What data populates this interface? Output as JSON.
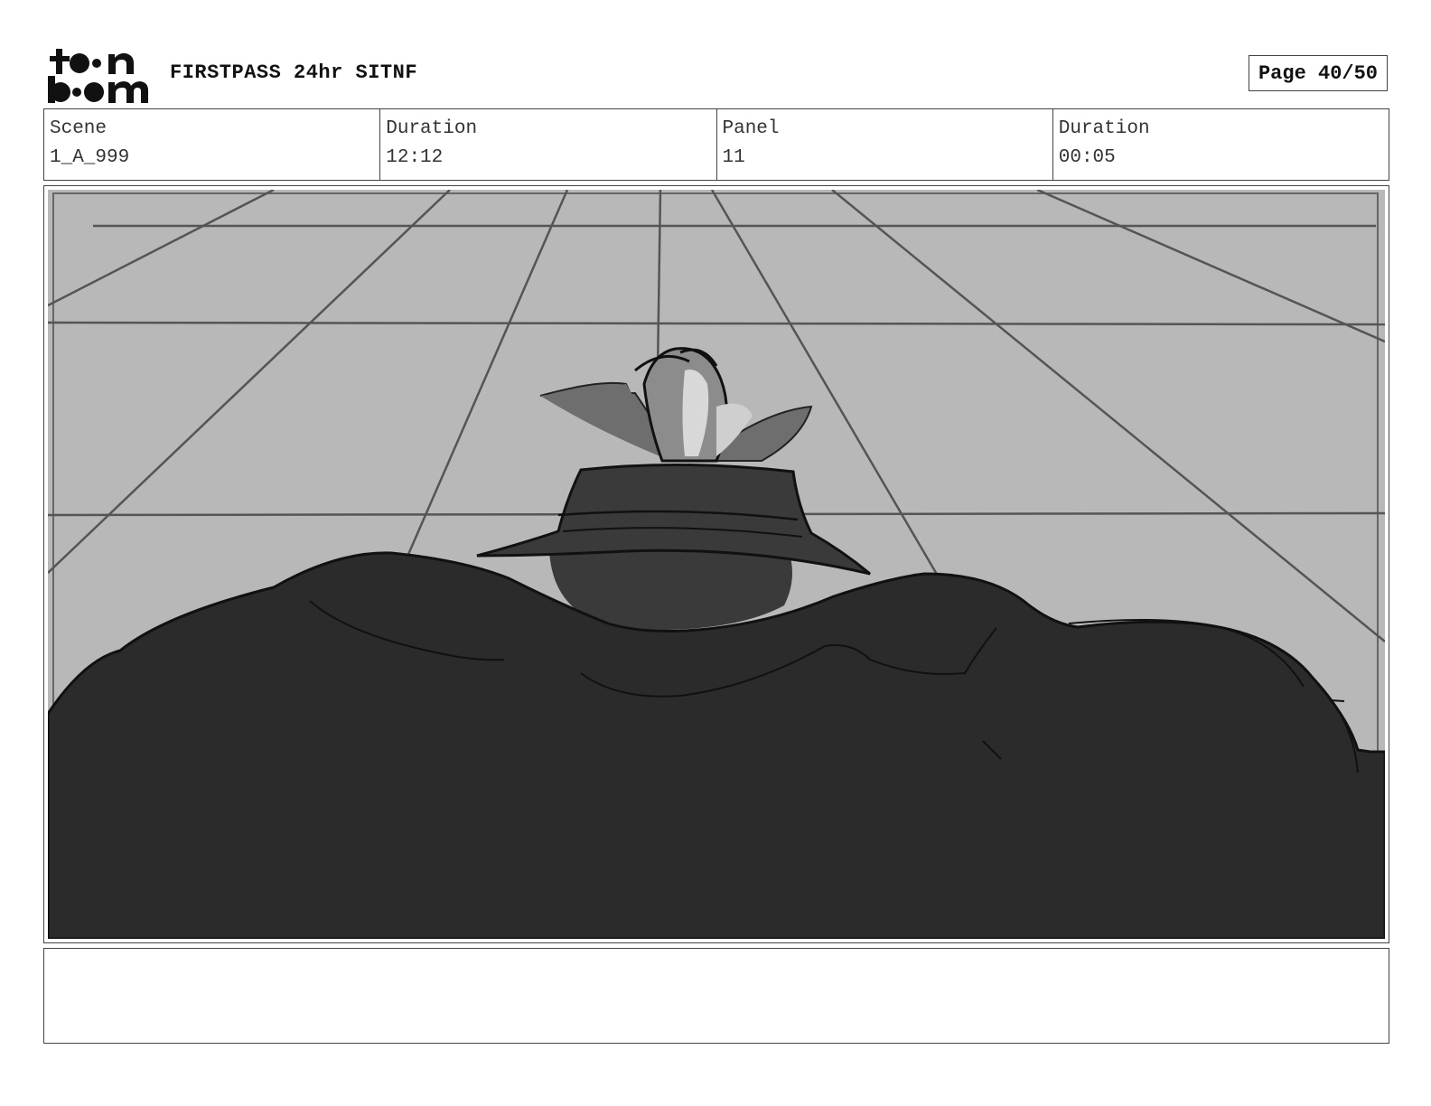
{
  "header": {
    "logo_name": "toon boom",
    "project_title": "FIRSTPASS 24hr SITNF",
    "page_label": "Page 40/50"
  },
  "info": [
    {
      "label": "Scene",
      "value": "1_A_999"
    },
    {
      "label": "Duration",
      "value": "12:12"
    },
    {
      "label": "Panel",
      "value": "11"
    },
    {
      "label": "Duration",
      "value": "00:05"
    }
  ],
  "panel": {
    "description": "",
    "colors": {
      "floor": "#b8b8b8",
      "grid_lines": "#555555",
      "foreground_mass": "#2b2b2b",
      "hat": "#3a3a3a",
      "head_midtone": "#6e6e6e",
      "head_highlight": "#d8d8d8"
    }
  },
  "notes": {
    "text": ""
  }
}
